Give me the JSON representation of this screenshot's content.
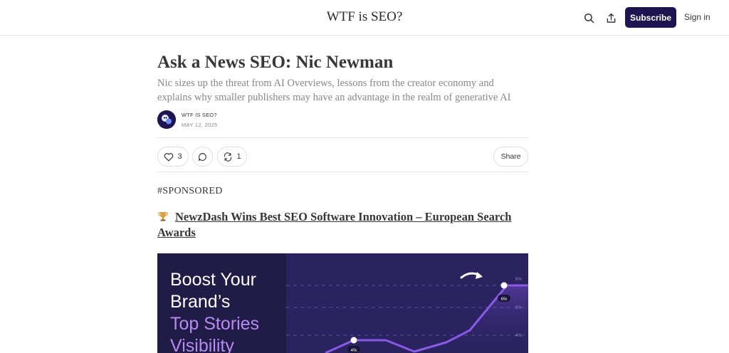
{
  "header": {
    "site_title": "WTF is SEO?",
    "subscribe_label": "Subscribe",
    "signin_label": "Sign in",
    "icons": [
      "search-icon",
      "share-icon"
    ]
  },
  "post": {
    "title": "Ask a News SEO: Nic Newman",
    "subtitle": "Nic sizes up the threat from AI Overviews, lessons from the creator economy and explains why smaller publishers may have an advantage in the realm of generative AI",
    "author": "WTF IS SEO?",
    "date": "MAY 12, 2025"
  },
  "actions": {
    "like_count": "3",
    "restack_count": "1",
    "share_label": "Share",
    "icons": [
      "heart-icon",
      "comment-icon",
      "restack-icon"
    ]
  },
  "body": {
    "tag": "#SPONSORED",
    "promo_link": "NewzDash Wins Best SEO Software Innovation – European Search Awards",
    "promo_icon": "trophy-icon"
  },
  "banner": {
    "lines": [
      "Boost Your",
      "Brand’s",
      "Top Stories",
      "Visibility"
    ],
    "chart_labels": {
      "y_ticks": [
        "6%",
        "5%",
        "4%"
      ],
      "point_top": "6%",
      "point_low": "4%"
    }
  },
  "colors": {
    "brand": "#1f1450",
    "accent_purple": "#b78af5",
    "text": "#363737",
    "muted": "#868787"
  }
}
